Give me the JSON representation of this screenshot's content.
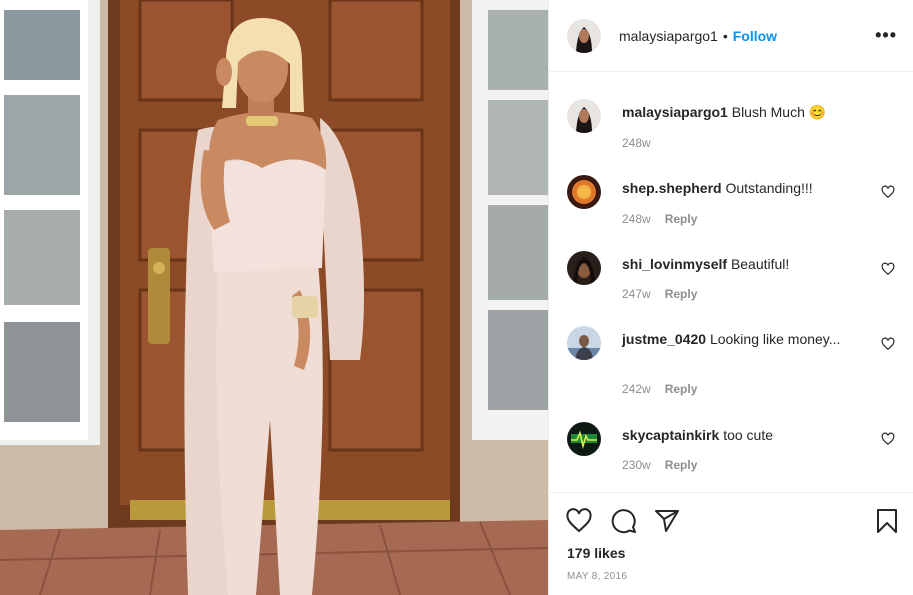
{
  "post": {
    "author": "malaysiapargo1",
    "dot": "•",
    "follow_label": "Follow",
    "more_label": "•••"
  },
  "caption": {
    "user": "malaysiapargo1",
    "text": "Blush Much 😊",
    "time": "248w"
  },
  "comments": [
    {
      "user": "shep.shepherd",
      "text": "Outstanding!!!",
      "time": "248w",
      "reply": "Reply"
    },
    {
      "user": "shi_lovinmyself",
      "text": "Beautiful!",
      "time": "247w",
      "reply": "Reply"
    },
    {
      "user": "justme_0420",
      "text": "Looking like money...",
      "time": "242w",
      "reply": "Reply"
    },
    {
      "user": "skycaptainkirk",
      "text": "too cute",
      "time": "230w",
      "reply": "Reply"
    }
  ],
  "footer": {
    "likes": "179 likes",
    "date": "MAY 8, 2016"
  },
  "icons": {
    "like": "heart-icon",
    "comment": "comment-bubble-icon",
    "share": "paper-plane-icon",
    "save": "bookmark-icon",
    "more": "more-options-icon"
  },
  "colors": {
    "accent": "#0095f6",
    "muted": "#8e8e8e",
    "text": "#262626",
    "border": "#efefef"
  }
}
